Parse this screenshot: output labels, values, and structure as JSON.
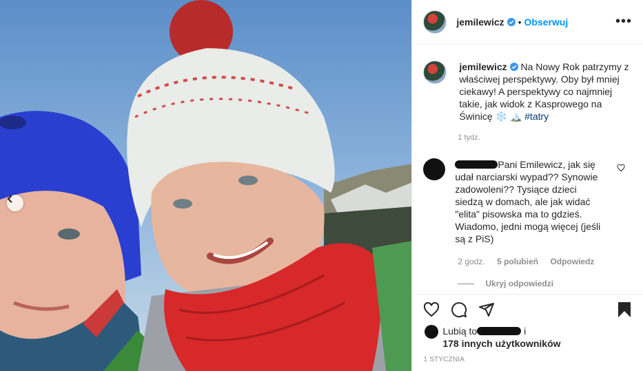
{
  "header": {
    "username": "jemilewicz",
    "separator": "•",
    "follow_label": "Obserwuj",
    "more_label": "•••"
  },
  "caption": {
    "username": "jemilewicz",
    "text": "Na Nowy Rok patrzymy z właściwej perspektywy. Oby był mniej ciekawy! A perspektywy co najmniej takie, jak widok z Kasprowego na Świnicę ❄️ 🏔️",
    "hashtag": "#tatry",
    "time": "1 tydz."
  },
  "comment": {
    "text": "Pani Emilewicz, jak się udał narciarski wypad?? Synowie zadowoleni?? Tysiące dzieci siedzą w domach, ale jak widać \"elita\" pisowska ma to gdzieś. Wiadomo, jedni mogą więcej (jeśli są z PiS)",
    "time": "2 godz.",
    "likes": "5 polubień",
    "reply_label": "Odpowiedz",
    "hide_replies_label": "Ukryj odpowiedzi"
  },
  "likes": {
    "line1_prefix": "Lubią to",
    "line1_suffix": "i",
    "line2": "178 innych użytkowników"
  },
  "post_date": "1 STYCZNIA",
  "colors": {
    "accent": "#0095f6",
    "hashtag": "#00376b",
    "text": "#262626",
    "muted": "#8e8e8e"
  },
  "icons": [
    "verified-badge-icon",
    "more-options-icon",
    "heart-icon",
    "comment-icon",
    "share-icon",
    "bookmark-icon",
    "chevron-left-icon"
  ]
}
